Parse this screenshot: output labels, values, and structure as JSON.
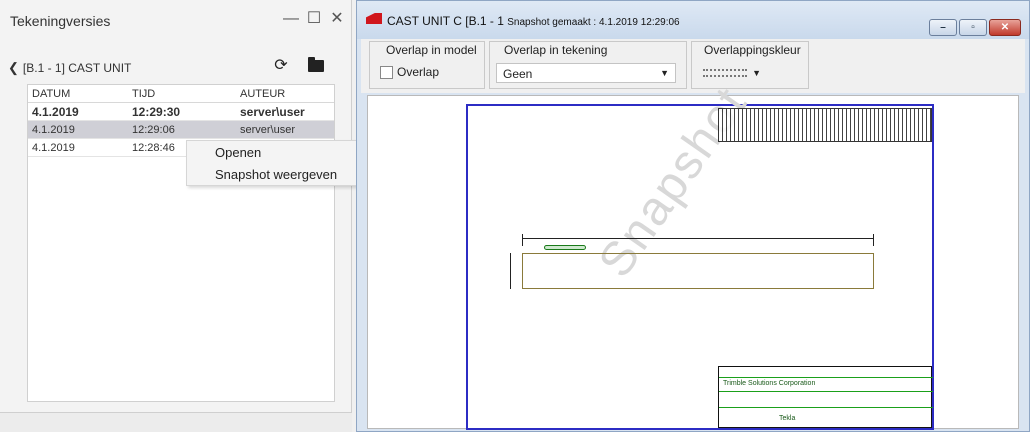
{
  "left_panel": {
    "title": "Tekeningversies",
    "controls": {
      "minimize": "—",
      "maximize": "☐",
      "close": "✕"
    },
    "path": "[B.1 - 1] CAST UNIT",
    "table": {
      "headers": [
        "DATUM",
        "TIJD",
        "AUTEUR"
      ],
      "rows": [
        {
          "date": "4.1.2019",
          "time": "12:29:30",
          "author": "server\\user"
        },
        {
          "date": "4.1.2019",
          "time": "12:29:06",
          "author": "server\\user"
        },
        {
          "date": "4.1.2019",
          "time": "12:28:46",
          "author": ""
        }
      ]
    },
    "context_menu": [
      "Openen",
      "Snapshot weergeven"
    ]
  },
  "right_window": {
    "title_main": "CAST UNIT C  [B.1 - 1",
    "title_small": "Snapshot gemaakt : 4.1.2019 12:29:06",
    "window_buttons": {
      "minimize": "–",
      "maximize": "▫",
      "close": "✕"
    },
    "toolbar": {
      "overlap_model_label": "Overlap in model",
      "overlap_checkbox_label": "Overlap",
      "overlap_drawing_label": "Overlap in tekening",
      "overlap_drawing_value": "Geen",
      "overlap_color_label": "Overlappingskleur"
    },
    "watermark": "Snapshot",
    "title_block_text": [
      "Trimble Solutions Corporation",
      "Tekla"
    ]
  },
  "colors": {
    "accent_blue": "#2c2cc4",
    "selection": "#cfcfd6",
    "app_icon": "#d0161c"
  }
}
